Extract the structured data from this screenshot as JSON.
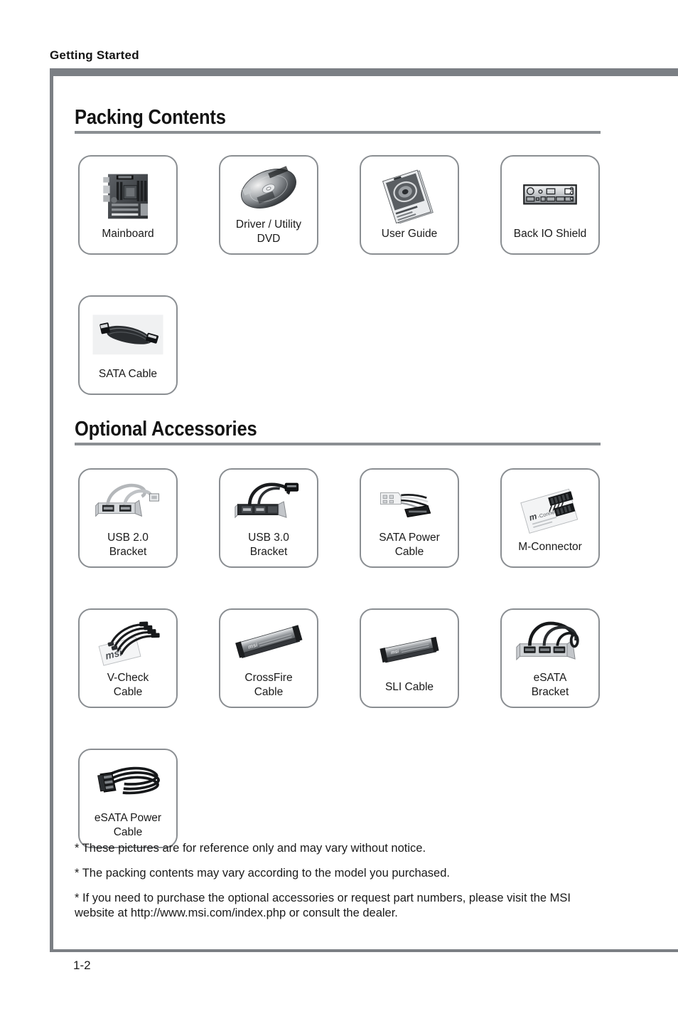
{
  "page": {
    "running_head": "Getting Started",
    "page_number": "1-2",
    "rule_color": "#7b7f84",
    "box_border_color": "#8a8e92"
  },
  "packing": {
    "title": "Packing Contents",
    "items": [
      {
        "label": "Mainboard",
        "icon": "mainboard-photo",
        "single_line": true
      },
      {
        "label": "Driver / Utility\nDVD",
        "icon": "dvd-disc-photo",
        "single_line": false
      },
      {
        "label": "User Guide",
        "icon": "user-guide-booklet-photo",
        "single_line": true
      },
      {
        "label": "Back IO Shield",
        "icon": "back-io-shield-photo",
        "single_line": true
      },
      {
        "label": "SATA Cable",
        "icon": "sata-cable-photo",
        "single_line": true
      }
    ]
  },
  "optional": {
    "title": "Optional Accessories",
    "items": [
      {
        "label": "USB 2.0\nBracket",
        "icon": "usb2-bracket-photo",
        "single_line": false
      },
      {
        "label": "USB 3.0\nBracket",
        "icon": "usb3-bracket-photo",
        "single_line": false
      },
      {
        "label": "SATA Power\nCable",
        "icon": "sata-power-cable-photo",
        "single_line": false
      },
      {
        "label": "M-Connector",
        "icon": "m-connector-photo",
        "single_line": true
      },
      {
        "label": "V-Check\nCable",
        "icon": "v-check-cable-photo",
        "single_line": false
      },
      {
        "label": "CrossFire\nCable",
        "icon": "crossfire-cable-photo",
        "single_line": false
      },
      {
        "label": "SLI Cable",
        "icon": "sli-cable-photo",
        "single_line": true
      },
      {
        "label": "eSATA\nBracket",
        "icon": "esata-bracket-photo",
        "single_line": false
      },
      {
        "label": "eSATA Power\nCable",
        "icon": "esata-power-cable-photo",
        "single_line": false
      }
    ]
  },
  "notes": [
    "* These pictures are for reference only and may vary without notice.",
    "* The packing contents may vary according to the model you purchased.",
    "* If you need to purchase the optional accessories or request part numbers, please visit the MSI website at http://www.msi.com/index.php or consult the dealer."
  ]
}
